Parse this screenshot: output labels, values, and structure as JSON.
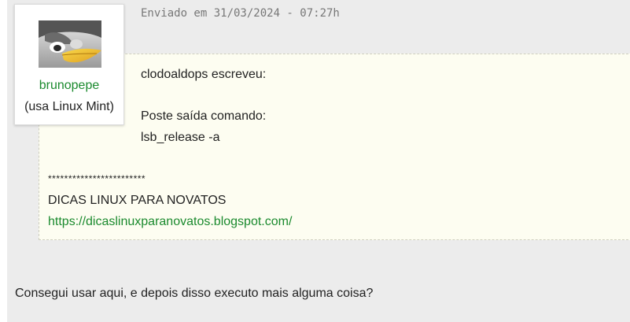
{
  "post": {
    "date": "Enviado em 31/03/2024 - 07:27h",
    "reply_text": "Consegui usar aqui, e depois disso executo mais alguma coisa?"
  },
  "user": {
    "name": "brunopepe",
    "distro": "(usa Linux Mint)",
    "avatar_icon": "tux-avatar-icon"
  },
  "quote": {
    "author": "clodoaldops escreveu:",
    "lines": [
      "Poste saída comando:",
      "lsb_release -a"
    ]
  },
  "signature": {
    "stars": "************************",
    "title": "DICAS LINUX PARA NOVATOS",
    "link": "https://dicaslinuxparanovatos.blogspot.com/"
  },
  "colors": {
    "background": "#ececec",
    "quote_background": "#fdfdf1",
    "link": "#1b8a2e",
    "username": "#1b8a2e"
  }
}
